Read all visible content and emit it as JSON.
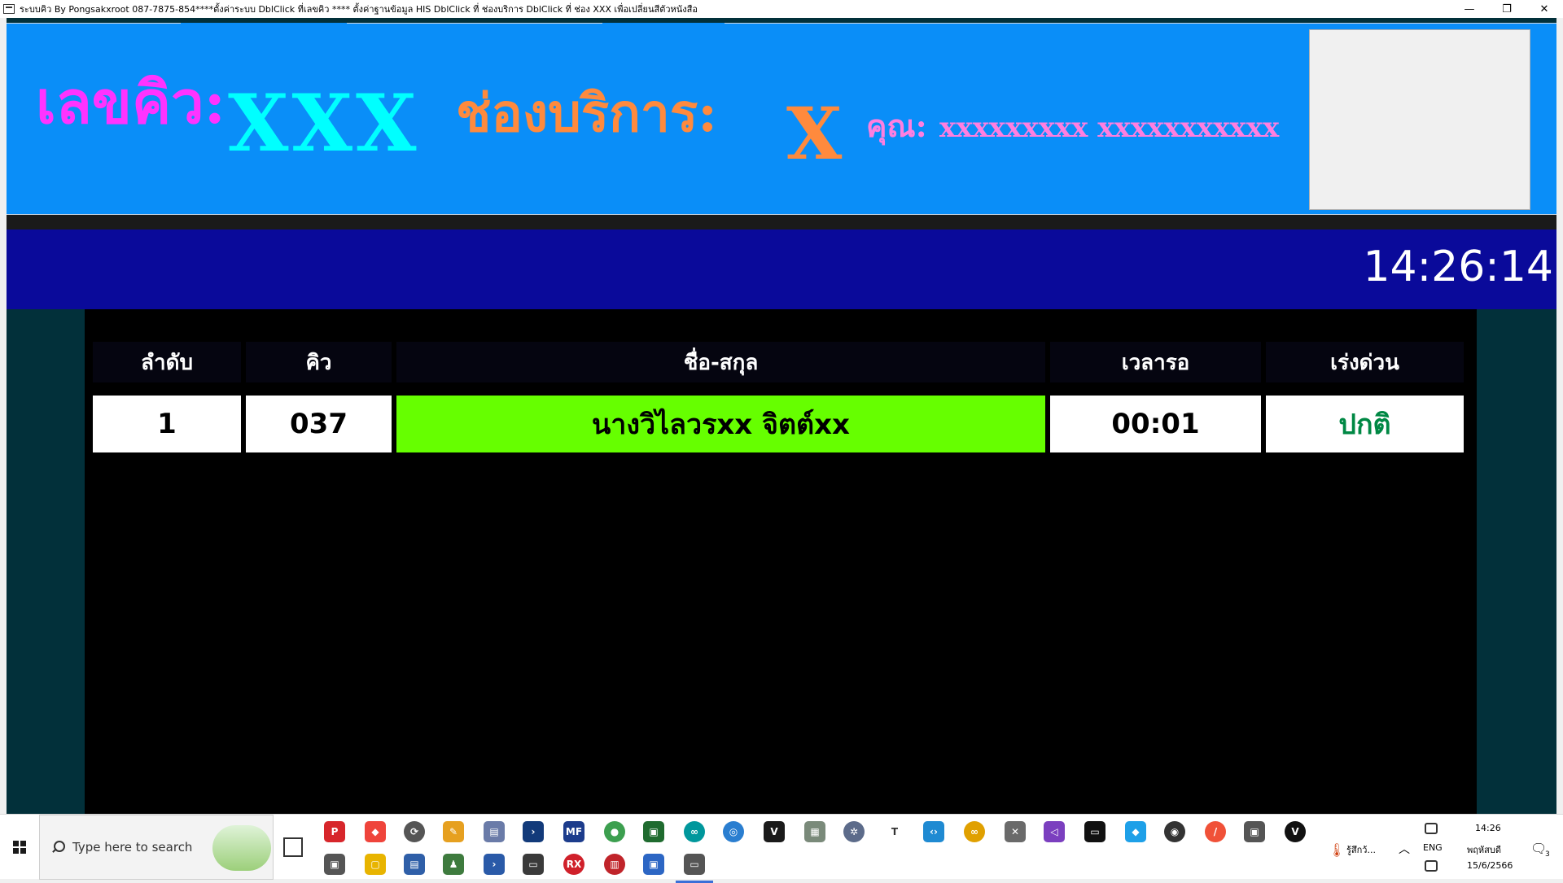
{
  "window": {
    "title": "ระบบคิว By Pongsakxroot 087-7875-854****ตั้งค่าระบบ DblClick ที่เลขคิว **** ตั้งค่าฐานข้อมูล HIS DblClick ที่ ช่องบริการ DblClick ที่ ช่อง XXX เพื่อเปลี่ยนสีตัวหนังสือ",
    "minimize": "—",
    "restore": "❐",
    "close": "✕"
  },
  "banner": {
    "queue_label": "เลขคิว:",
    "queue_value": "XXX",
    "counter_label": "ช่องบริการ:",
    "counter_value": "X",
    "name_label": "คุณ:",
    "name_value": "xxxxxxxxx xxxxxxxxxxx",
    "colors": {
      "background": "#0a8ef8",
      "queue_label": "#ff33ff",
      "queue_value": "#00ffff",
      "counter": "#ff8a3d",
      "name": "#ff7fe0"
    }
  },
  "clock": {
    "time": "14:26:14"
  },
  "table": {
    "headers": [
      "ลำดับ",
      "คิว",
      "ชื่อ-สกุล",
      "เวลารอ",
      "เร่งด่วน"
    ],
    "rows": [
      {
        "order": "1",
        "queue": "037",
        "name": "นางวิไลวรxx จิตต์xx",
        "wait": "00:01",
        "urgency": "ปกติ"
      }
    ],
    "colors": {
      "name_cell": "#66ff00",
      "urgency_text": "#008844"
    }
  },
  "taskbar": {
    "search_placeholder": "Type here to search",
    "icons": [
      "pdf-icon",
      "anydesk-icon",
      "settings-sync-icon",
      "notes-icon",
      "file-manager-icon",
      "terminal-icon",
      "mf-icon",
      "chrome-icon",
      "network-icon",
      "arduino-icon",
      "browser-icon",
      "vnc-icon",
      "image-viewer-icon",
      "gear-icon",
      "text-icon",
      "vscode-icon",
      "pairing-icon",
      "tools-icon",
      "visual-studio-icon",
      "monitor-icon",
      "app-icon",
      "obs-icon",
      "swift-icon",
      "window-stack-icon",
      "vivaldi-icon",
      "window-copy-icon",
      "explorer-icon",
      "desktop-icon",
      "users-icon",
      "powershell-icon",
      "folder-icon",
      "rx-icon",
      "archive-icon",
      "remote-icon",
      "active-app-icon"
    ],
    "weather_text": "รู้สึกว้...",
    "language": "ENG",
    "time": "14:26",
    "day": "พฤหัสบดี",
    "date": "15/6/2566",
    "notification_count": "3"
  }
}
